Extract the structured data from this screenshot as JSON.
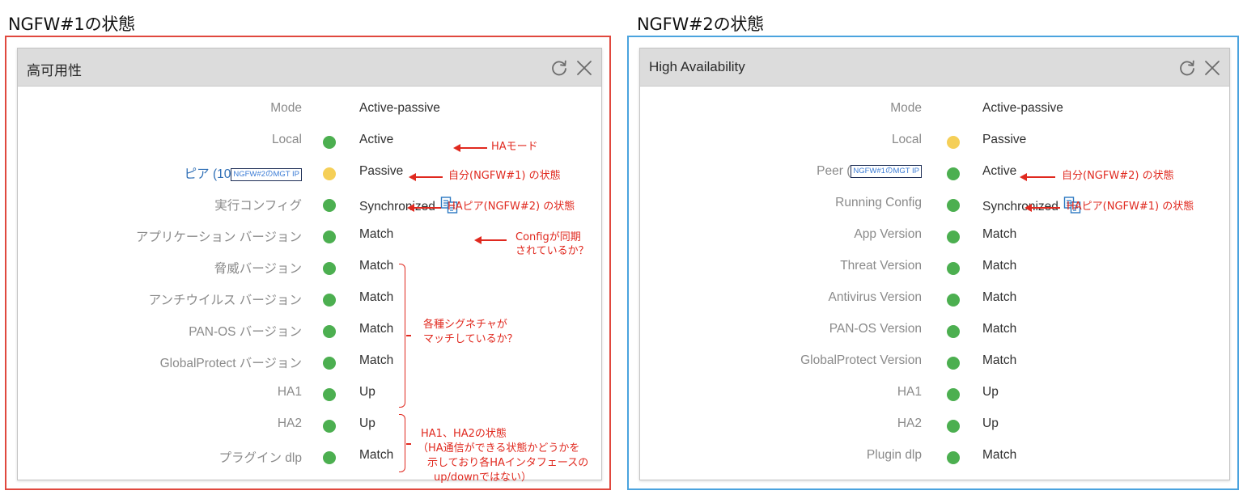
{
  "panels": [
    {
      "heading": "NGFW#1の状態",
      "widget_title": "高可用性",
      "rows": [
        {
          "label": "Mode",
          "value": "Active-passive",
          "dot": null
        },
        {
          "label": "Local",
          "value": "Active",
          "dot": "green"
        },
        {
          "label": "ピア (10",
          "peer_box": "NGFW#2のMGT IP",
          "value": "Passive",
          "dot": "yellow"
        },
        {
          "label": "実行コンフィグ",
          "value": "Synchronized",
          "dot": "green",
          "icon": "sync-details-icon"
        },
        {
          "label": "アプリケーション バージョン",
          "value": "Match",
          "dot": "green"
        },
        {
          "label": "脅威バージョン",
          "value": "Match",
          "dot": "green"
        },
        {
          "label": "アンチウイルス バージョン",
          "value": "Match",
          "dot": "green"
        },
        {
          "label": "PAN-OS バージョン",
          "value": "Match",
          "dot": "green"
        },
        {
          "label": "GlobalProtect バージョン",
          "value": "Match",
          "dot": "green"
        },
        {
          "label": "HA1",
          "value": "Up",
          "dot": "green"
        },
        {
          "label": "HA2",
          "value": "Up",
          "dot": "green"
        },
        {
          "label": "プラグイン dlp",
          "value": "Match",
          "dot": "green"
        }
      ],
      "annotations": {
        "mode": "HAモード",
        "local": "自分(NGFW#1) の状態",
        "peer": "HAピア(NGFW#2) の状態",
        "config_1": "Configが同期",
        "config_2": "されているか？",
        "versions_1": "各種シグネチャが",
        "versions_2": "マッチしているか？",
        "ha_1": "HA1、HA2の状態",
        "ha_2": "（HA通信ができる状態かどうかを",
        "ha_3": "示しており各HAインタフェースの",
        "ha_4": "up/downではない）"
      }
    },
    {
      "heading": "NGFW#2の状態",
      "widget_title": "High Availability",
      "rows": [
        {
          "label": "Mode",
          "value": "Active-passive",
          "dot": null
        },
        {
          "label": "Local",
          "value": "Passive",
          "dot": "yellow"
        },
        {
          "label": "Peer (",
          "peer_box": "NGFW#1のMGT IP",
          "value": "Active",
          "dot": "green"
        },
        {
          "label": "Running Config",
          "value": "Synchronized",
          "dot": "green",
          "icon": "sync-details-icon"
        },
        {
          "label": "App Version",
          "value": "Match",
          "dot": "green"
        },
        {
          "label": "Threat Version",
          "value": "Match",
          "dot": "green"
        },
        {
          "label": "Antivirus Version",
          "value": "Match",
          "dot": "green"
        },
        {
          "label": "PAN-OS Version",
          "value": "Match",
          "dot": "green"
        },
        {
          "label": "GlobalProtect Version",
          "value": "Match",
          "dot": "green"
        },
        {
          "label": "HA1",
          "value": "Up",
          "dot": "green"
        },
        {
          "label": "HA2",
          "value": "Up",
          "dot": "green"
        },
        {
          "label": "Plugin dlp",
          "value": "Match",
          "dot": "green"
        }
      ],
      "annotations": {
        "local": "自分(NGFW#2) の状態",
        "peer": "HAピア(NGFW#1) の状態"
      }
    }
  ],
  "colors": {
    "green": "#4caf50",
    "yellow": "#f5cf57",
    "annotation": "#e0291f",
    "frame_left": "#e0483e",
    "frame_right": "#4aa3de"
  }
}
